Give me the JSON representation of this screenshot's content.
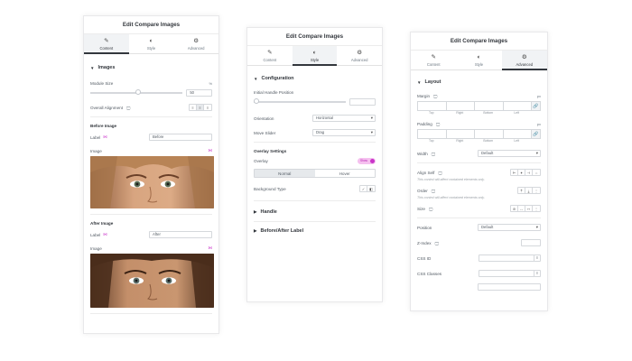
{
  "panels": {
    "p1": {
      "title": "Edit Compare Images",
      "tabs": [
        {
          "label": "Content",
          "icon": "pencil-icon"
        },
        {
          "label": "Style",
          "icon": "half-circle-icon"
        },
        {
          "label": "Advanced",
          "icon": "gear-icon"
        }
      ],
      "section": "Images",
      "module_size_label": "Module Size",
      "module_size_value": "50",
      "unit": "%",
      "overall_alignment_label": "Overall Alignment",
      "before_title": "Before Image",
      "before_label_label": "Label",
      "before_label_value": "Before",
      "before_image_label": "Image",
      "after_title": "After Image",
      "after_label_label": "Label",
      "after_label_value": "After",
      "after_image_label": "Image"
    },
    "p2": {
      "title": "Edit Compare Images",
      "tabs": [
        {
          "label": "Content",
          "icon": "pencil-icon"
        },
        {
          "label": "Style",
          "icon": "half-circle-icon"
        },
        {
          "label": "Advanced",
          "icon": "gear-icon"
        }
      ],
      "section": "Configuration",
      "initial_handle_label": "Initial Handle Position",
      "orientation_label": "Orientation",
      "orientation_value": "Horizontal",
      "move_slider_label": "Move Slider",
      "move_slider_value": "Drag",
      "overlay_settings_label": "Overlay Settings",
      "overlay_label": "Overlay",
      "overlay_toggle": "Show",
      "normal_tab": "Normal",
      "hover_tab": "Hover",
      "background_type_label": "Background Type",
      "handle_section": "Handle",
      "before_after_section": "Before/After Label"
    },
    "p3": {
      "title": "Edit Compare Images",
      "tabs": [
        {
          "label": "Content",
          "icon": "pencil-icon"
        },
        {
          "label": "Style",
          "icon": "half-circle-icon"
        },
        {
          "label": "Advanced",
          "icon": "gear-icon"
        }
      ],
      "section": "Layout",
      "margin_label": "Margin",
      "padding_label": "Padding",
      "unit": "px",
      "dims": [
        "Top",
        "Right",
        "Bottom",
        "Left"
      ],
      "width_label": "Width",
      "width_value": "Default",
      "align_self_label": "Align Self",
      "note": "This control will affect contained elements only.",
      "order_label": "Order",
      "size_label": "Size",
      "position_label": "Position",
      "position_value": "Default",
      "zindex_label": "Z-Index",
      "cssid_label": "CSS ID",
      "cssclasses_label": "CSS Classes"
    }
  },
  "colors": {
    "accent": "#c935c9",
    "text": "#33373d",
    "border": "#d5d8dc"
  }
}
